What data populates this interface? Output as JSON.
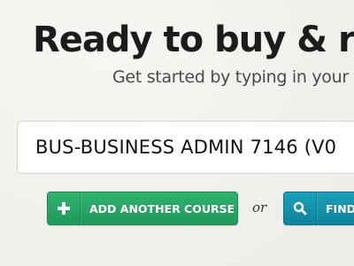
{
  "hero": {
    "headline": "Ready to buy & re",
    "subheadline": "Get started by typing in your"
  },
  "search": {
    "value": "BUS-BUSINESS ADMIN 7146 (V0"
  },
  "actions": {
    "add_course_label": "ADD ANOTHER COURSE",
    "or_text": "or",
    "find_label": "FIND"
  },
  "icons": {
    "add": "plus-icon",
    "find": "search-icon"
  },
  "colors": {
    "add_button": "#22a35f",
    "find_button": "#1390ab",
    "headline": "#1c1c1c",
    "background": "#f4f3ef"
  }
}
